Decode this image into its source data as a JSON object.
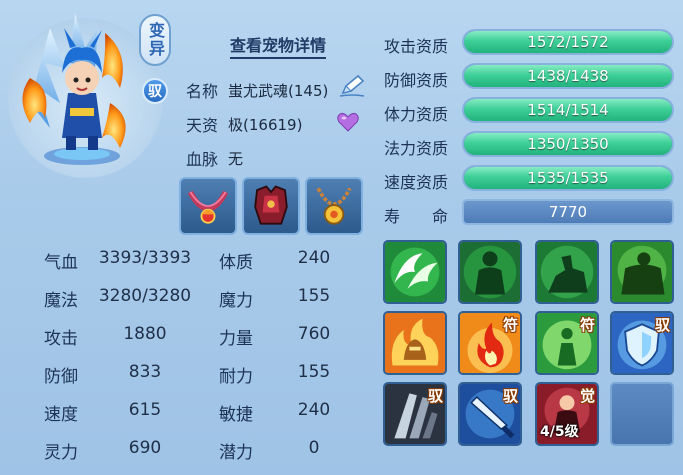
{
  "pet": {
    "tag_variant": "变异",
    "tag_yu": "驭",
    "detail_link": "查看宠物详情",
    "name_label": "名称",
    "name_value": "蚩尤武魂(145)",
    "talent_label": "天资",
    "talent_value": "极(16619)",
    "bloodline_label": "血脉",
    "bloodline_value": "无"
  },
  "equipment": [
    "equip-necklace-red",
    "equip-armor-red",
    "equip-amulet-gold"
  ],
  "stats": [
    {
      "label": "气血",
      "value": "3393/3393",
      "label2": "体质",
      "value2": "240"
    },
    {
      "label": "魔法",
      "value": "3280/3280",
      "label2": "魔力",
      "value2": "155"
    },
    {
      "label": "攻击",
      "value": "1880",
      "label2": "力量",
      "value2": "760"
    },
    {
      "label": "防御",
      "value": "833",
      "label2": "耐力",
      "value2": "155"
    },
    {
      "label": "速度",
      "value": "615",
      "label2": "敏捷",
      "value2": "240"
    },
    {
      "label": "灵力",
      "value": "690",
      "label2": "潜力",
      "value2": "0"
    }
  ],
  "aptitudes": [
    {
      "label": "攻击资质",
      "value": "1572/1572",
      "fill": 1.0
    },
    {
      "label": "防御资质",
      "value": "1438/1438",
      "fill": 1.0
    },
    {
      "label": "体力资质",
      "value": "1514/1514",
      "fill": 1.0
    },
    {
      "label": "法力资质",
      "value": "1350/1350",
      "fill": 1.0
    },
    {
      "label": "速度资质",
      "value": "1535/1535",
      "fill": 1.0
    }
  ],
  "life": {
    "label": "寿　　命",
    "value": "7770"
  },
  "skills": [
    {
      "icon": "wings-icon",
      "badge": ""
    },
    {
      "icon": "green-figure-icon",
      "badge": ""
    },
    {
      "icon": "horseman-icon",
      "badge": ""
    },
    {
      "icon": "brute-icon",
      "badge": ""
    },
    {
      "icon": "fire-helmet-icon",
      "badge": ""
    },
    {
      "icon": "flame-icon",
      "badge": "符"
    },
    {
      "icon": "glow-figure-icon",
      "badge": "符"
    },
    {
      "icon": "shield-icon",
      "badge": "驭"
    },
    {
      "icon": "blades-icon",
      "badge": "驭"
    },
    {
      "icon": "sword-icon",
      "badge": "驭"
    },
    {
      "icon": "awaken-icon",
      "badge": "觉",
      "level": "4/5级"
    },
    {
      "icon": "empty-slot",
      "badge": ""
    }
  ]
}
